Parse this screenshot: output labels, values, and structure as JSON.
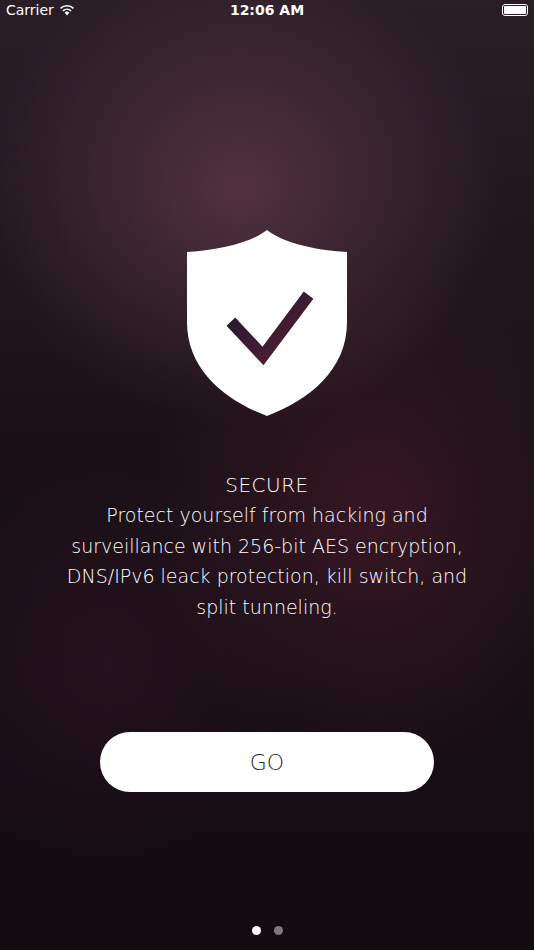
{
  "status_bar": {
    "carrier": "Carrier",
    "time": "12:06 AM"
  },
  "slide": {
    "title": "SECURE",
    "description": "Protect yourself from hacking and surveillance with 256-bit AES encryption, DNS/IPv6 leack protection, kill switch, and split tunneling."
  },
  "button": {
    "label": "GO"
  },
  "pages": [
    {
      "selected": true
    },
    {
      "selected": false
    }
  ]
}
